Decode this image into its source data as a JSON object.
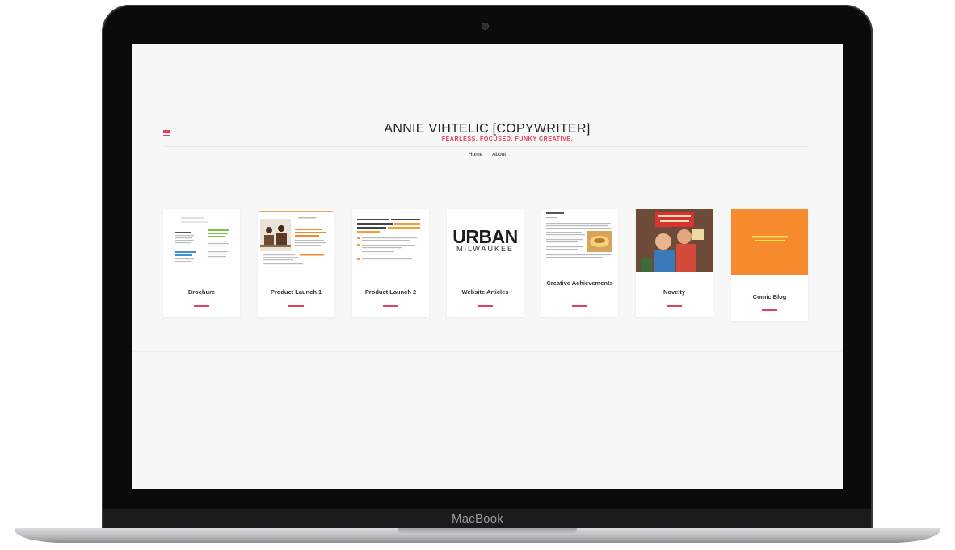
{
  "device": {
    "brand": "MacBook"
  },
  "site": {
    "title": "ANNIE VIHTELIC [COPYWRITER]",
    "tagline": "FEARLESS. FOCUSED. FUNKY CREATIVE.",
    "menu_icon": "hamburger-icon",
    "nav": [
      {
        "label": "Home"
      },
      {
        "label": "About"
      }
    ]
  },
  "portfolio": {
    "items": [
      {
        "label": "Brochure"
      },
      {
        "label": "Product Launch 1"
      },
      {
        "label": "Product Launch 2"
      },
      {
        "label": "Website Articles",
        "thumb_word": "URBAN",
        "thumb_sub": "MILWAUKEE"
      },
      {
        "label": "Creative Achievements"
      },
      {
        "label": "Novelty"
      },
      {
        "label": "Comic Blog"
      }
    ]
  },
  "colors": {
    "accent": "#e2405a",
    "comic_orange": "#f58a2e"
  }
}
